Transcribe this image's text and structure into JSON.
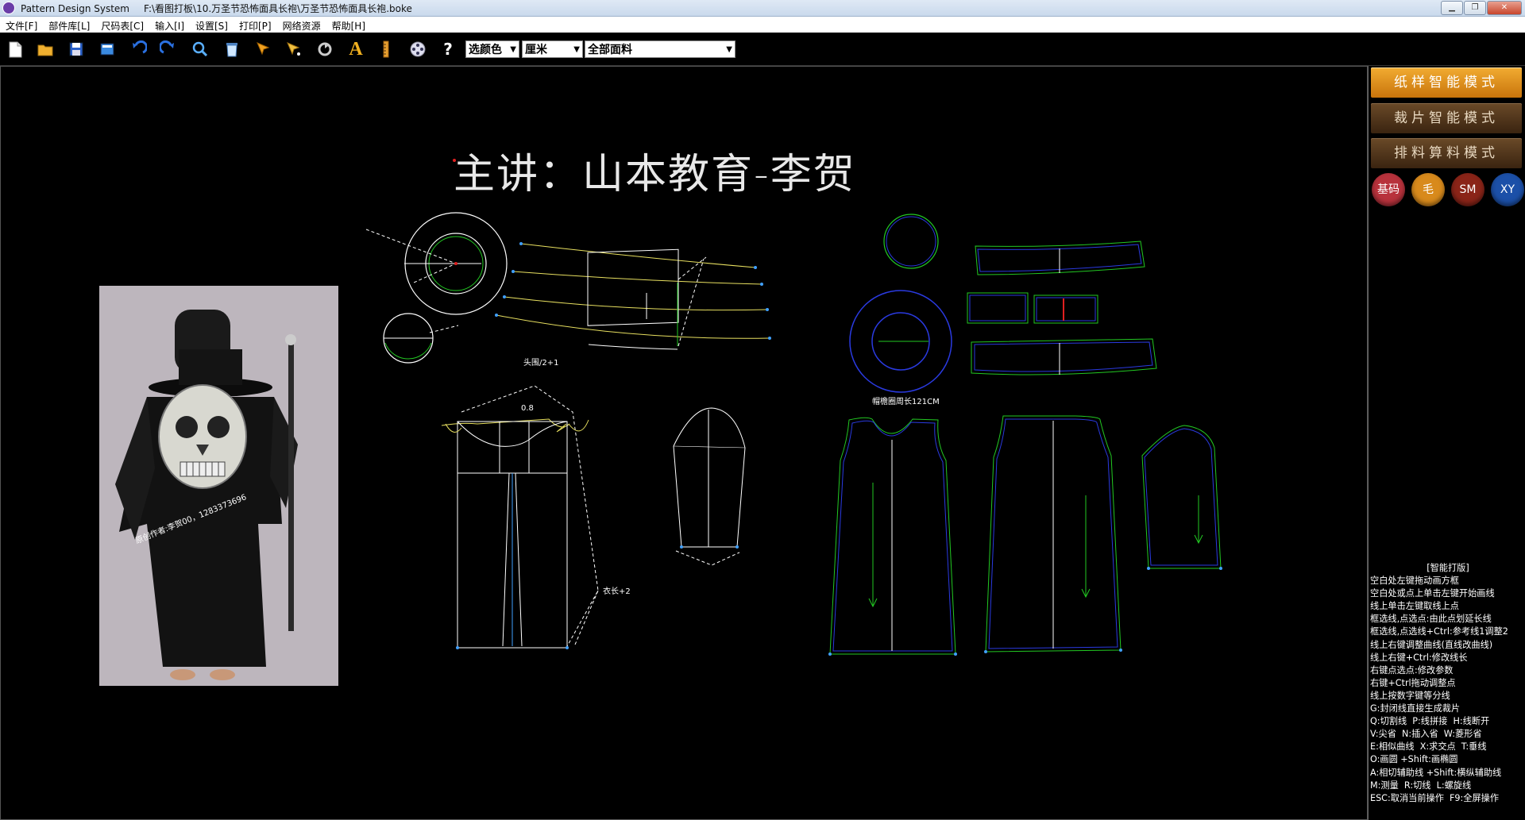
{
  "window": {
    "app_name": "Pattern Design System",
    "file_path": "F:\\看图打板\\10.万圣节恐怖面具长袍\\万圣节恐怖面具长袍.boke"
  },
  "menu": [
    "文件[F]",
    "部件库[L]",
    "尺码表[C]",
    "输入[I]",
    "设置[S]",
    "打印[P]",
    "网络资源",
    "帮助[H]"
  ],
  "toolbar": {
    "icons": [
      "new-file-icon",
      "open-folder-icon",
      "save-icon",
      "save-as-icon",
      "undo-icon",
      "redo-icon",
      "zoom-icon",
      "delete-icon",
      "select-arrow-icon",
      "point-arrow-icon",
      "rotate-icon",
      "text-icon",
      "ruler-icon",
      "film-reel-icon",
      "help-icon"
    ],
    "color_select": "选颜色",
    "unit_select": "厘米",
    "fabric_select": "全部面料",
    "help_label": "?",
    "text_label": "A"
  },
  "canvas": {
    "lecturer_text": "主讲：山本教育-李贺",
    "photo_watermark": "原创作者:李贺00，1283373696",
    "labels": {
      "head_circ": "头围/2+1",
      "hat_circ": "帽檐圈周长121CM",
      "robe_length": "衣长+2",
      "small_value": "0.8"
    }
  },
  "right_panel": {
    "mode_buttons": [
      "纸样智能模式",
      "裁片智能模式",
      "排料算料模式"
    ],
    "circle_buttons": [
      {
        "label": "基码",
        "color": "#b8323c"
      },
      {
        "label": "毛",
        "color": "#d88a1c"
      },
      {
        "label": "SM",
        "color": "#8a2418"
      },
      {
        "label": "XY",
        "color": "#1c50a8"
      }
    ],
    "help_title": "[智能打版]",
    "help_lines": [
      "空白处左键拖动画方框",
      "空白处或点上单击左键开始画线",
      "线上单击左键取线上点",
      "框选线,点选点:由此点划延长线",
      "框选线,点选线+Ctrl:参考线1调整2",
      "线上右键调整曲线(直线改曲线)",
      "线上右键+Ctrl:修改线长",
      "右键点选点:修改参数",
      "右键+Ctrl拖动调整点",
      "线上按数字键等分线",
      "G:封闭线直接生成裁片",
      "Q:切割线  P:线拼接  H:线断开",
      "V:尖省  N:插入省  W:菱形省",
      "E:相似曲线  X:求交点  T:垂线",
      "O:画圆 +Shift:画椭圆",
      "A:相切辅助线 +Shift:横纵辅助线",
      "M:测量  R:切线  L:螺旋线",
      "ESC:取消当前操作  F9:全屏操作"
    ]
  },
  "colors": {
    "pattern_line": "#ffffff",
    "curve_line": "#e8e060",
    "seam_line": "#22c822",
    "outline_blue": "#2a3ae0",
    "point_cyan": "#40a0ff",
    "mode_orange": "#e8951e"
  }
}
